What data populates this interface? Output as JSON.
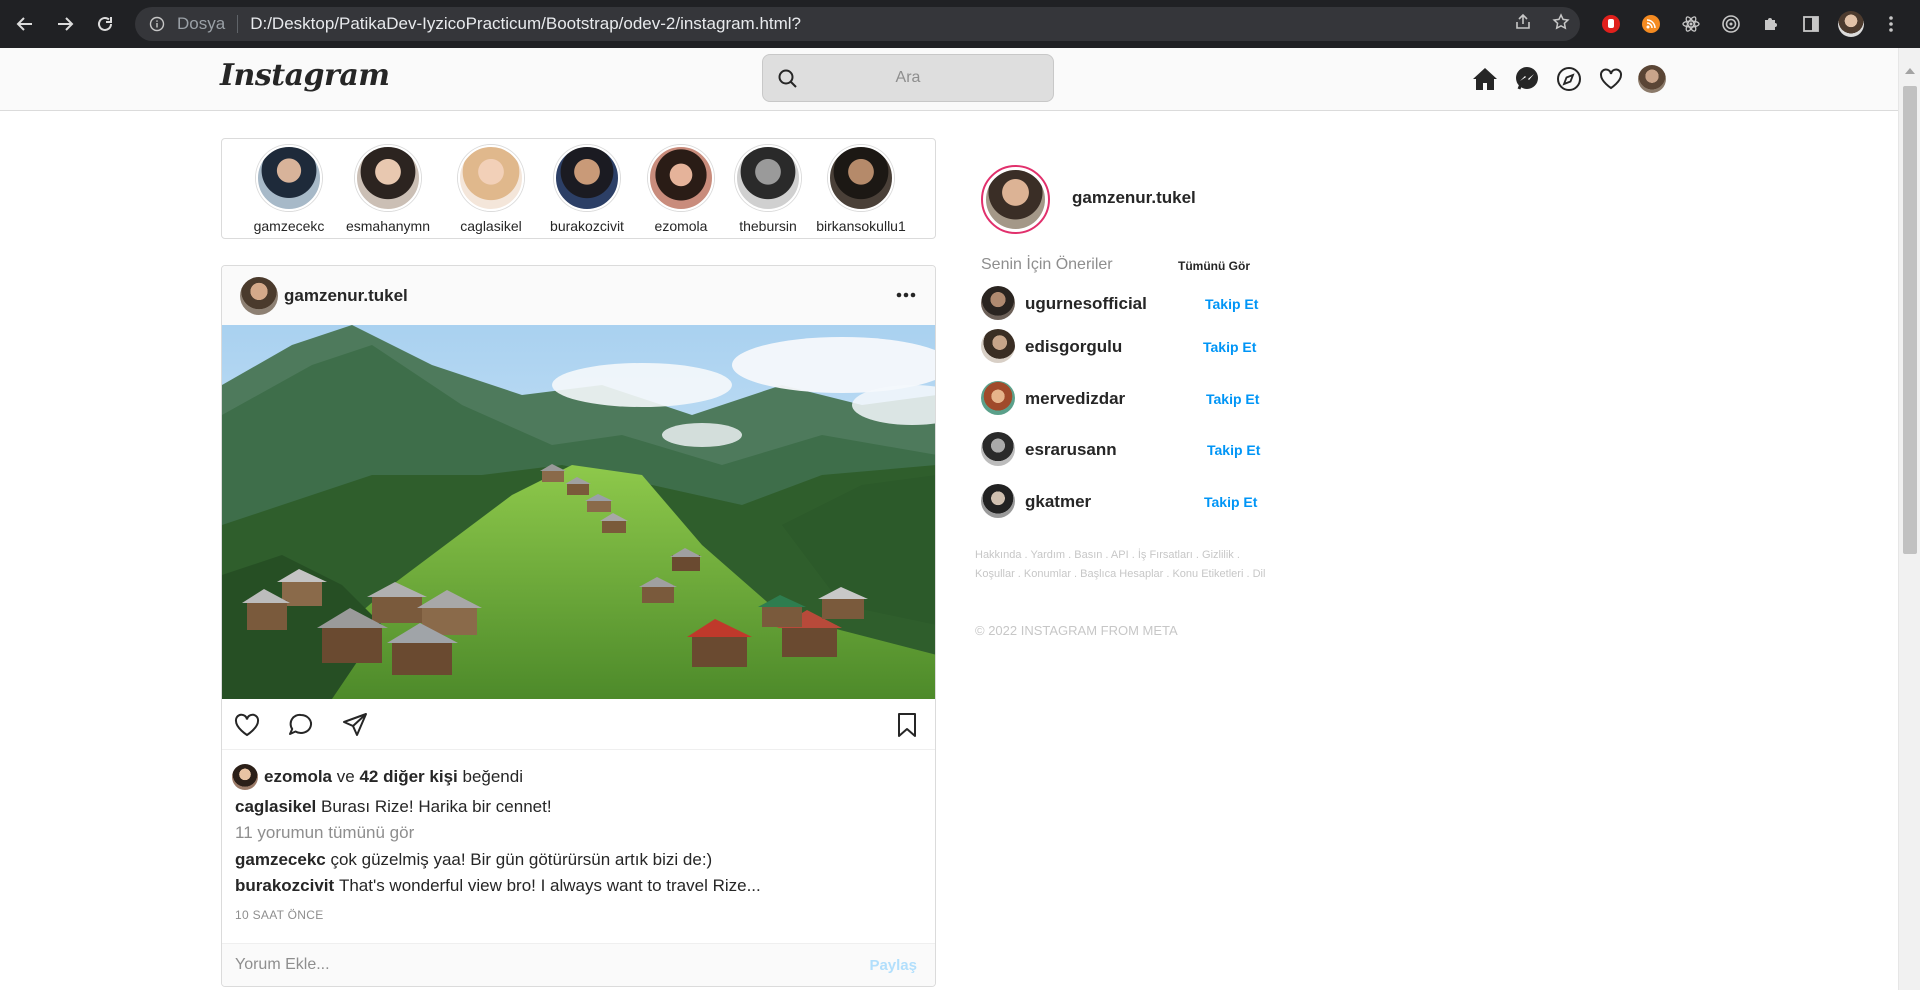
{
  "browser": {
    "scheme": "Dosya",
    "url": "D:/Desktop/PatikaDev-IyzicoPracticum/Bootstrap/odev-2/instagram.html?"
  },
  "header": {
    "logo": "Instagram",
    "search_placeholder": "Ara"
  },
  "stories": [
    {
      "name": "gamzecekc"
    },
    {
      "name": "esmahanymn"
    },
    {
      "name": "caglasikel"
    },
    {
      "name": "burakozcivit"
    },
    {
      "name": "ezomola"
    },
    {
      "name": "thebursin"
    },
    {
      "name": "birkansokullu1"
    }
  ],
  "post": {
    "username": "gamzenur.tukel",
    "likes": {
      "user": "ezomola",
      "connector": "ve",
      "others": "42 diğer kişi",
      "suffix": "beğendi"
    },
    "caption": {
      "user": "caglasikel",
      "text": "Burası Rize! Harika bir cennet!"
    },
    "view_all": "11 yorumun tümünü gör",
    "comments": [
      {
        "user": "gamzecekc",
        "text": "çok güzelmiş yaa! Bir gün götürürsün artık bizi de:)"
      },
      {
        "user": "burakozcivit",
        "text": "That's wonderful view bro! I always want to travel Rize..."
      }
    ],
    "time": "10 SAAT ÖNCE",
    "comment_placeholder": "Yorum Ekle...",
    "share_label": "Paylaş"
  },
  "sidebar": {
    "username": "gamzenur.tukel",
    "suggestions_title": "Senin İçin Öneriler",
    "see_all": "Tümünü Gör",
    "follow_label": "Takip Et",
    "suggestions": [
      {
        "name": "ugurnesofficial"
      },
      {
        "name": "edisgorgulu"
      },
      {
        "name": "mervedizdar"
      },
      {
        "name": "esrarusann"
      },
      {
        "name": "gkatmer"
      }
    ],
    "footer_links": "Hakkında . Yardım . Basın . API . İş Fırsatları . Gizlilik . Koşullar . Konumlar . Başlıca Hesaplar . Konu Etiketleri . Dil",
    "copyright": "© 2022 INSTAGRAM FROM META"
  }
}
